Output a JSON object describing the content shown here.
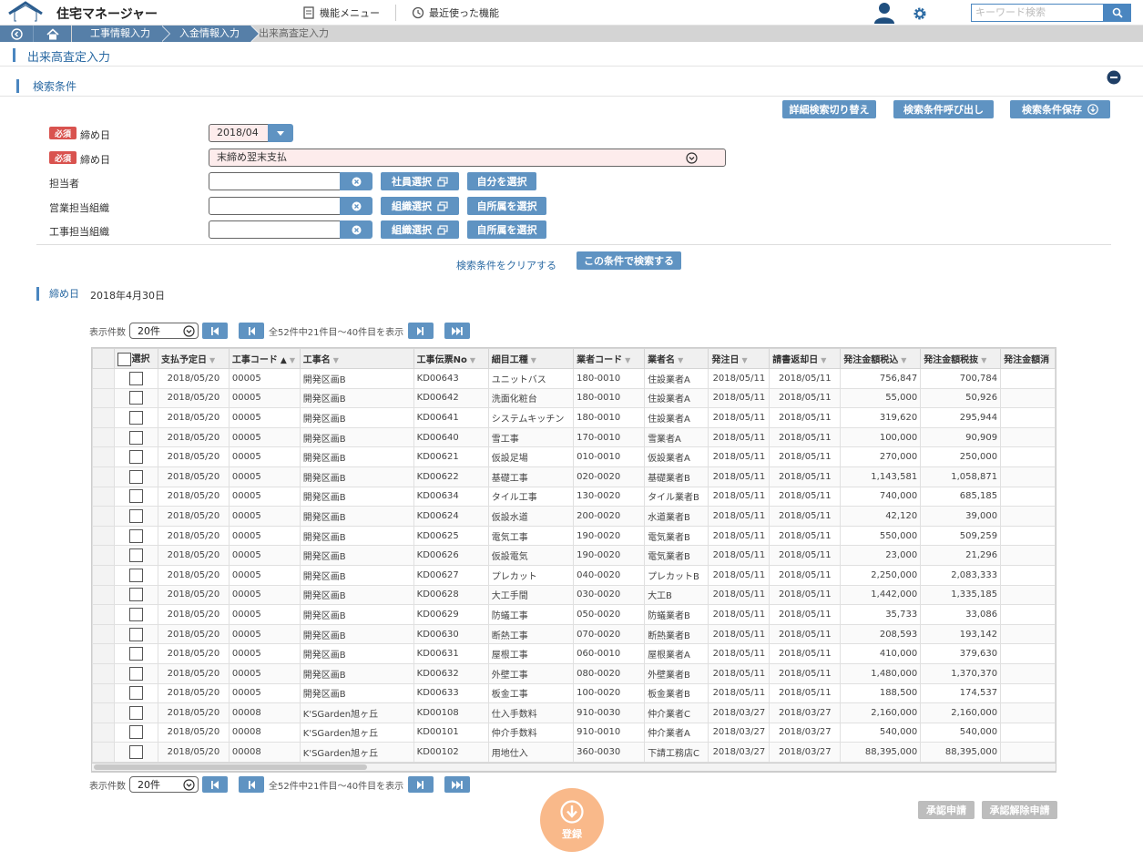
{
  "header": {
    "app_title": "住宅マネージャー",
    "logo_text": "住宅マネージャー",
    "menu_label": "機能メニュー",
    "recent_label": "最近使った機能",
    "search_placeholder": "キーワード検索"
  },
  "breadcrumb": {
    "items": [
      "工事情報入力",
      "入金情報入力"
    ],
    "current": "出来高査定入力"
  },
  "page_title": "出来高査定入力",
  "search_section": {
    "title": "検索条件",
    "buttons": {
      "detail_toggle": "詳細検索切り替え",
      "recall": "検索条件呼び出し",
      "save": "検索条件保存"
    },
    "required_badge": "必須",
    "fields": {
      "close_date_label": "締め日",
      "close_date_value": "2018/04",
      "close_type_label": "締め日",
      "close_type_value": "末締め翌末支払",
      "staff_label": "担当者",
      "sales_org_label": "営業担当組織",
      "construction_org_label": "工事担当組織"
    },
    "side_buttons": {
      "staff_select": "社員選択",
      "self_select": "自分を選択",
      "org_select": "組織選択",
      "own_dept": "自所属を選択"
    },
    "clear_link": "検索条件をクリアする",
    "search_button": "この条件で検索する"
  },
  "result": {
    "close_label": "締め日",
    "close_value": "2018年4月30日"
  },
  "pager": {
    "count_label": "表示件数",
    "count_value": "20件",
    "summary": "全52件中21件目～40件目を表示"
  },
  "table": {
    "columns": [
      "選択",
      "支払予定日",
      "工事コード",
      "工事名",
      "工事伝票No",
      "細目工種",
      "業者コード",
      "業者名",
      "発注日",
      "請書返却日",
      "発注金額税込",
      "発注金額税抜",
      "発注金額消"
    ],
    "rows": [
      [
        "2018/05/20",
        "00005",
        "開発区画B",
        "KD00643",
        "ユニットバス",
        "180-0010",
        "住設業者A",
        "2018/05/11",
        "2018/05/11",
        "756,847",
        "700,784"
      ],
      [
        "2018/05/20",
        "00005",
        "開発区画B",
        "KD00642",
        "洗面化粧台",
        "180-0010",
        "住設業者A",
        "2018/05/11",
        "2018/05/11",
        "55,000",
        "50,926"
      ],
      [
        "2018/05/20",
        "00005",
        "開発区画B",
        "KD00641",
        "システムキッチン",
        "180-0010",
        "住設業者A",
        "2018/05/11",
        "2018/05/11",
        "319,620",
        "295,944"
      ],
      [
        "2018/05/20",
        "00005",
        "開発区画B",
        "KD00640",
        "雪工事",
        "170-0010",
        "雪業者A",
        "2018/05/11",
        "2018/05/11",
        "100,000",
        "90,909"
      ],
      [
        "2018/05/20",
        "00005",
        "開発区画B",
        "KD00621",
        "仮設足場",
        "010-0010",
        "仮設業者A",
        "2018/05/11",
        "2018/05/11",
        "270,000",
        "250,000"
      ],
      [
        "2018/05/20",
        "00005",
        "開発区画B",
        "KD00622",
        "基礎工事",
        "020-0020",
        "基礎業者B",
        "2018/05/11",
        "2018/05/11",
        "1,143,581",
        "1,058,871"
      ],
      [
        "2018/05/20",
        "00005",
        "開発区画B",
        "KD00634",
        "タイル工事",
        "130-0020",
        "タイル業者B",
        "2018/05/11",
        "2018/05/11",
        "740,000",
        "685,185"
      ],
      [
        "2018/05/20",
        "00005",
        "開発区画B",
        "KD00624",
        "仮設水道",
        "200-0020",
        "水道業者B",
        "2018/05/11",
        "2018/05/11",
        "42,120",
        "39,000"
      ],
      [
        "2018/05/20",
        "00005",
        "開発区画B",
        "KD00625",
        "電気工事",
        "190-0020",
        "電気業者B",
        "2018/05/11",
        "2018/05/11",
        "550,000",
        "509,259"
      ],
      [
        "2018/05/20",
        "00005",
        "開発区画B",
        "KD00626",
        "仮設電気",
        "190-0020",
        "電気業者B",
        "2018/05/11",
        "2018/05/11",
        "23,000",
        "21,296"
      ],
      [
        "2018/05/20",
        "00005",
        "開発区画B",
        "KD00627",
        "プレカット",
        "040-0020",
        "プレカットB",
        "2018/05/11",
        "2018/05/11",
        "2,250,000",
        "2,083,333"
      ],
      [
        "2018/05/20",
        "00005",
        "開発区画B",
        "KD00628",
        "大工手間",
        "030-0020",
        "大工B",
        "2018/05/11",
        "2018/05/11",
        "1,442,000",
        "1,335,185"
      ],
      [
        "2018/05/20",
        "00005",
        "開発区画B",
        "KD00629",
        "防蟻工事",
        "050-0020",
        "防蟻業者B",
        "2018/05/11",
        "2018/05/11",
        "35,733",
        "33,086"
      ],
      [
        "2018/05/20",
        "00005",
        "開発区画B",
        "KD00630",
        "断熱工事",
        "070-0020",
        "断熱業者B",
        "2018/05/11",
        "2018/05/11",
        "208,593",
        "193,142"
      ],
      [
        "2018/05/20",
        "00005",
        "開発区画B",
        "KD00631",
        "屋根工事",
        "060-0010",
        "屋根業者A",
        "2018/05/11",
        "2018/05/11",
        "410,000",
        "379,630"
      ],
      [
        "2018/05/20",
        "00005",
        "開発区画B",
        "KD00632",
        "外壁工事",
        "080-0020",
        "外壁業者B",
        "2018/05/11",
        "2018/05/11",
        "1,480,000",
        "1,370,370"
      ],
      [
        "2018/05/20",
        "00005",
        "開発区画B",
        "KD00633",
        "板金工事",
        "100-0020",
        "板金業者B",
        "2018/05/11",
        "2018/05/11",
        "188,500",
        "174,537"
      ],
      [
        "2018/05/20",
        "00008",
        "K'SGarden旭ヶ丘",
        "KD00108",
        "仕入手数料",
        "910-0030",
        "仲介業者C",
        "2018/03/27",
        "2018/03/27",
        "2,160,000",
        "2,160,000"
      ],
      [
        "2018/05/20",
        "00008",
        "K'SGarden旭ヶ丘",
        "KD00101",
        "仲介手数料",
        "910-0010",
        "仲介業者A",
        "2018/03/27",
        "2018/03/27",
        "540,000",
        "540,000"
      ],
      [
        "2018/05/20",
        "00008",
        "K'SGarden旭ヶ丘",
        "KD00102",
        "用地仕入",
        "360-0030",
        "下請工務店C",
        "2018/03/27",
        "2018/03/27",
        "88,395,000",
        "88,395,000"
      ]
    ]
  },
  "footer": {
    "approve_request": "承認申請",
    "cancel_request": "承認解除申請",
    "register": "登録"
  },
  "colors": {
    "primary": "#5f93c2",
    "breadcrumb": "#567fa8",
    "required": "#d9534f",
    "register": "#f9b98a",
    "disabled": "#bdbdbd"
  }
}
